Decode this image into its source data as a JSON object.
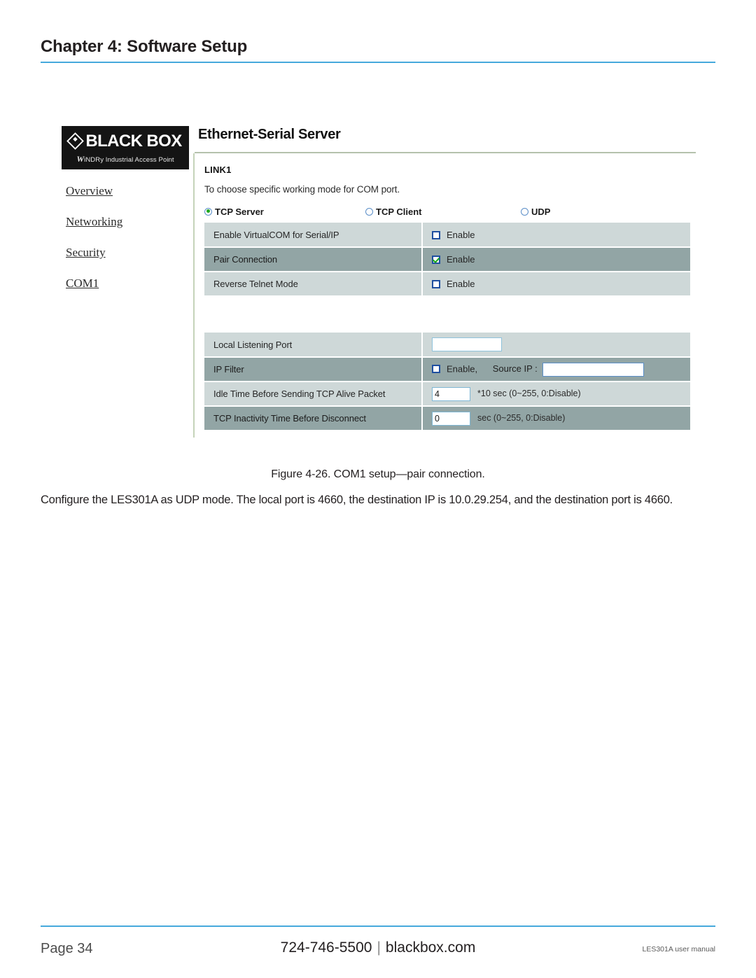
{
  "page": {
    "chapter_title": "Chapter 4: Software Setup",
    "figure_caption": "Figure 4-26. COM1 setup—pair connection.",
    "body_paragraph": "Configure the LES301A as UDP mode. The local port is 4660, the destination IP is 10.0.29.254, and the destination port is 4660."
  },
  "footer": {
    "page_label": "Page 34",
    "phone": "724-746-5500",
    "separator": "|",
    "website": "blackbox.com",
    "manual": "LES301A user manual"
  },
  "webui": {
    "logo": {
      "brand": "BLACK BOX",
      "tagline_w": "W",
      "tagline_rest": "iNDRy Industrial Access Point"
    },
    "nav": {
      "items": [
        {
          "label": "Overview"
        },
        {
          "label": "Networking"
        },
        {
          "label": "Security"
        },
        {
          "label": "COM1"
        }
      ]
    },
    "title": "Ethernet-Serial Server",
    "panel": {
      "link_label": "LINK1",
      "description": "To choose specific working mode for COM port.",
      "modes": [
        {
          "label": "TCP Server",
          "selected": true
        },
        {
          "label": "TCP Client",
          "selected": false
        },
        {
          "label": "UDP",
          "selected": false
        }
      ],
      "table1": [
        {
          "label": "Enable VirtualCOM for Serial/IP",
          "checkbox_label": "Enable",
          "checked": false,
          "highlight": false
        },
        {
          "label": "Pair Connection",
          "checkbox_label": "Enable",
          "checked": true,
          "highlight": true
        },
        {
          "label": "Reverse Telnet Mode",
          "checkbox_label": "Enable",
          "checked": false,
          "highlight": false
        }
      ],
      "table2": {
        "local_listening_port": {
          "label": "Local Listening Port",
          "value": ""
        },
        "ip_filter": {
          "label": "IP Filter",
          "checkbox_label": "Enable,",
          "checked": false,
          "source_ip_label": "Source IP :",
          "source_ip_value": ""
        },
        "idle_time": {
          "label": "Idle Time Before Sending TCP Alive Packet",
          "value": "4",
          "hint": "*10 sec (0~255, 0:Disable)"
        },
        "inactivity_time": {
          "label": "TCP Inactivity Time Before Disconnect",
          "value": "0",
          "hint": "sec (0~255, 0:Disable)"
        }
      }
    }
  },
  "colors": {
    "accent_rule": "#46a9dc",
    "row_light": "#ced8d8",
    "row_dark": "#92a5a5",
    "panel_border": "#c5d3b9",
    "radio_checked": "#1fa81f"
  }
}
